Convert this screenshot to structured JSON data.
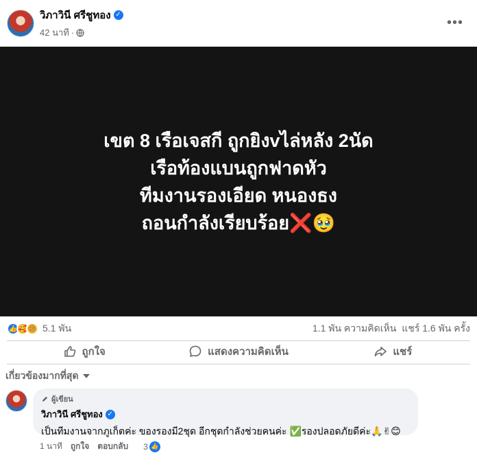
{
  "post": {
    "author": "วิภาวินี ศรีชูทอง",
    "time": "42 นาที",
    "time_separator": "·",
    "more": "•••"
  },
  "media": {
    "lines": [
      "เขต 8 เรือเจสกี ถูกยิงvไล่หลัง 2นัด",
      "เรือท้องแบนถูกฟาดหัว",
      "ทีมงานรองเอียด หนองธง",
      "ถอนกำลังเรียบร้อย❌🥹"
    ]
  },
  "stats": {
    "reaction_count": "5.1 พัน",
    "comments": "1.1 พัน ความคิดเห็น",
    "shares": "แชร์ 1.6 พัน ครั้ง",
    "reactions": [
      "like",
      "care",
      "sad"
    ]
  },
  "actions": {
    "like": "ถูกใจ",
    "comment": "แสดงความคิดเห็น",
    "share": "แชร์"
  },
  "sort": {
    "label": "เกี่ยวข้องมากที่สุด"
  },
  "comment": {
    "badge": "ผู้เขียน",
    "author": "วิภาวินี ศรีชูทอง",
    "text": "เป็นทีมงานจากภูเก็ตค่ะ ของรองมี2ชุด อีกชุดกำลังช่วยคนค่ะ ✅รองปลอดภัยดีค่ะ🙏✌😊",
    "time": "1 นาที",
    "like": "ถูกใจ",
    "reply": "ตอบกลับ",
    "like_count": "3"
  },
  "colors": {
    "accent": "#1877f2",
    "muted": "#65676b",
    "media_bg": "#141414"
  }
}
